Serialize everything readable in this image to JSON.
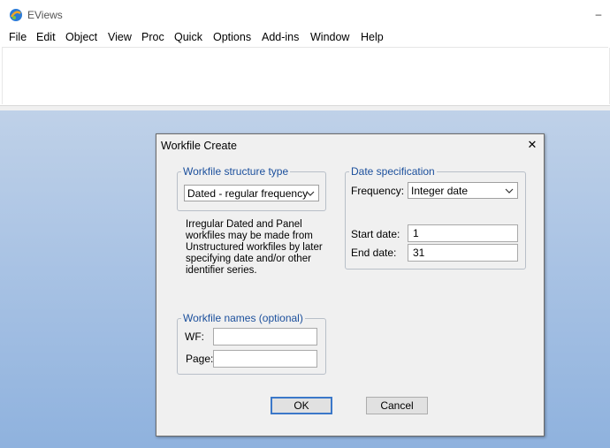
{
  "window": {
    "title": "EViews",
    "minimize_glyph": "–"
  },
  "menubar": {
    "items": [
      "File",
      "Edit",
      "Object",
      "View",
      "Proc",
      "Quick",
      "Options",
      "Add-ins",
      "Window",
      "Help"
    ]
  },
  "dialog": {
    "title": "Workfile Create",
    "close_glyph": "✕",
    "structure_group": {
      "label": "Workfile structure type",
      "selected": "Dated - regular frequency"
    },
    "info_lines": [
      "Irregular Dated and Panel",
      "workfiles may be made from",
      "Unstructured workfiles by later",
      "specifying date and/or other",
      "identifier series."
    ],
    "date_group": {
      "label": "Date specification",
      "frequency_label": "Frequency:",
      "frequency_value": "Integer date",
      "start_label": "Start date:",
      "start_value": "1",
      "end_label": "End date:",
      "end_value": "31"
    },
    "names_group": {
      "label": "Workfile names (optional)",
      "wf_label": "WF:",
      "wf_value": "",
      "page_label": "Page:",
      "page_value": ""
    },
    "ok_label": "OK",
    "cancel_label": "Cancel"
  },
  "icons": {
    "app": "eviews-logo-icon",
    "dropdown": "chevron-down-icon"
  },
  "colors": {
    "group_label": "#1b4f9c",
    "default_button_border": "#3b78c9",
    "workspace_top": "#bfd1e8",
    "workspace_bottom": "#8fb2de"
  }
}
